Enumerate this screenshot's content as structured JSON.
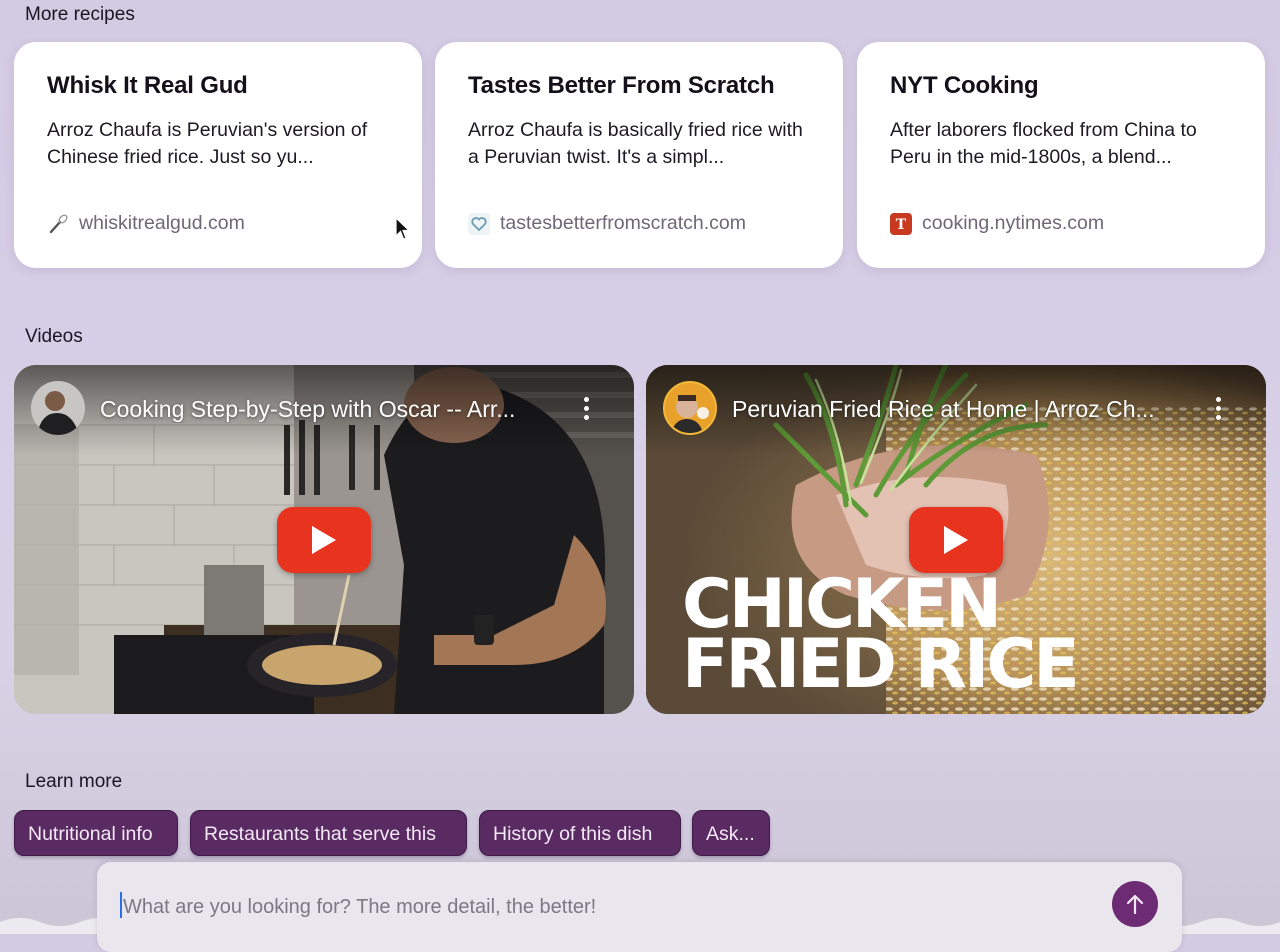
{
  "sections": {
    "recipes_title": "More recipes",
    "videos_title": "Videos",
    "learn_title": "Learn more"
  },
  "recipe_cards": [
    {
      "title": "Whisk It Real Gud",
      "description": "Arroz Chaufa is Peruvian's version of Chinese fried rice. Just so yu...",
      "source": "whiskitrealgud.com",
      "icon": "whisk-icon"
    },
    {
      "title": "Tastes Better From Scratch",
      "description": "Arroz Chaufa is basically fried rice with a Peruvian twist.  It's a simpl...",
      "source": "tastesbetterfromscratch.com",
      "icon": "heart-icon"
    },
    {
      "title": "NYT Cooking",
      "description": "After laborers flocked from China to Peru in the mid-1800s, a blend...",
      "source": "cooking.nytimes.com",
      "icon": "nyt-logo-icon"
    }
  ],
  "videos": [
    {
      "title": "Cooking Step-by-Step with Oscar -- Arr...",
      "overlay_text": ""
    },
    {
      "title": "Peruvian Fried Rice at Home | Arroz Ch...",
      "overlay_text_line1": "CHICKEN",
      "overlay_text_line2": "FRIED RICE"
    }
  ],
  "chips": [
    {
      "label": "Nutritional info"
    },
    {
      "label": "Restaurants that serve this"
    },
    {
      "label": "History of this dish"
    },
    {
      "label": "Ask..."
    }
  ],
  "search": {
    "placeholder": "What are you looking for? The more detail, the better!",
    "value": ""
  },
  "colors": {
    "accent": "#5a2a63",
    "play_button": "#e8331f",
    "background": "#d6cee6"
  }
}
